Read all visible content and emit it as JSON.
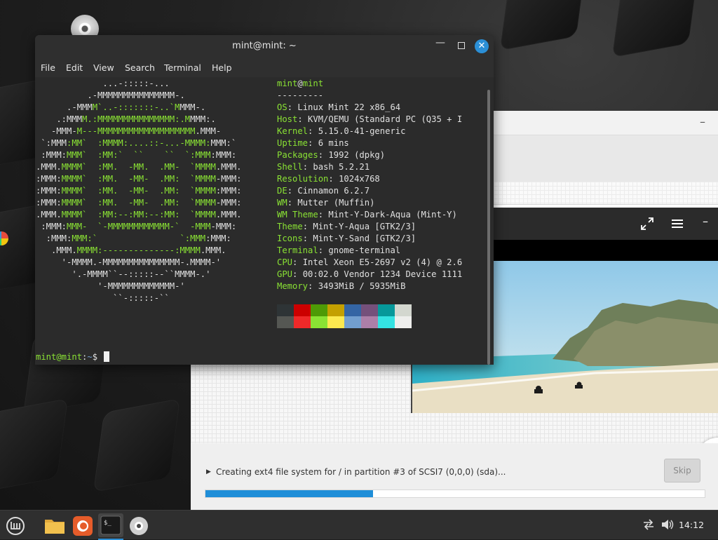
{
  "terminal": {
    "title": "mint@mint: ~",
    "menu": [
      "File",
      "Edit",
      "Search",
      "Terminal",
      "Help"
    ],
    "user": "mint",
    "host": "mint",
    "separator": "---------",
    "info": [
      {
        "key": "OS",
        "value": "Linux Mint 22 x86_64"
      },
      {
        "key": "Host",
        "value": "KVM/QEMU (Standard PC (Q35 + I"
      },
      {
        "key": "Kernel",
        "value": "5.15.0-41-generic"
      },
      {
        "key": "Uptime",
        "value": "6 mins"
      },
      {
        "key": "Packages",
        "value": "1992 (dpkg)"
      },
      {
        "key": "Shell",
        "value": "bash 5.2.21"
      },
      {
        "key": "Resolution",
        "value": "1024x768"
      },
      {
        "key": "DE",
        "value": "Cinnamon 6.2.7"
      },
      {
        "key": "WM",
        "value": "Mutter (Muffin)"
      },
      {
        "key": "WM Theme",
        "value": "Mint-Y-Dark-Aqua (Mint-Y)"
      },
      {
        "key": "Theme",
        "value": "Mint-Y-Aqua [GTK2/3]"
      },
      {
        "key": "Icons",
        "value": "Mint-Y-Sand [GTK2/3]"
      },
      {
        "key": "Terminal",
        "value": "gnome-terminal"
      },
      {
        "key": "CPU",
        "value": "Intel Xeon E5-2697 v2 (4) @ 2.6"
      },
      {
        "key": "GPU",
        "value": "00:02.0 Vendor 1234 Device 1111"
      },
      {
        "key": "Memory",
        "value": "3493MiB / 5935MiB"
      }
    ],
    "ascii_logo": [
      "             ...-:::::-...",
      "          .-MMMMMMMMMMMMMMM-.",
      "      .-MMMM`..-:::::::-..`MMMM-.",
      "    .:MMMM.:MMMMMMMMMMMMMMM:.MMMM:.",
      "   -MMM-M---MMMMMMMMMMMMMMMMMMM.MMM-",
      " `:MMM:MM`  :MMMM:....::-...-MMMM:MMM:`",
      " :MMM:MMM`  :MM:`  ``    ``  `:MMM:MMM:",
      ".MMM.MMMM`  :MM.  -MM.  .MM-  `MMMM.MMM.",
      ":MMM:MMMM`  :MM.  -MM-  .MM:  `MMMM-MMM:",
      ":MMM:MMMM`  :MM.  -MM-  .MM:  `MMMM:MMM:",
      ":MMM:MMMM`  :MM.  -MM-  .MM:  `MMMM-MMM:",
      ".MMM.MMMM`  :MM:--:MM:--:MM:  `MMMM.MMM.",
      " :MMM:MMM-  `-MMMMMMMMMMMM-`  -MMM-MMM:",
      "  :MMM:MMM:`                `:MMM:MMM:",
      "   .MMM.MMMM:--------------:MMMM.MMM.",
      "     '-MMMM.-MMMMMMMMMMMMMMM-.MMMM-'",
      "       '.-MMMM``--:::::--``MMMM-.'",
      "            '-MMMMMMMMMMMMM-'",
      "               ``-:::::-``"
    ],
    "prompt_user": "mint@mint",
    "prompt_path": "~",
    "prompt_symbol": "$"
  },
  "palette": {
    "dark": [
      "#2e3436",
      "#cc0000",
      "#4e9a06",
      "#c4a000",
      "#3465a4",
      "#75507b",
      "#06989a",
      "#d3d7cf"
    ],
    "bright": [
      "#555753",
      "#ef2929",
      "#8ae234",
      "#fce94f",
      "#729fcf",
      "#ad7fa8",
      "#34e2e2",
      "#eeeeec"
    ]
  },
  "installer": {
    "progress_text": "Creating ext4 file system for / in partition #3 of SCSI7 (0,0,0) (sda)...",
    "skip_label": "Skip",
    "progress_fraction": 0.335
  },
  "panel": {
    "clock": "14:12"
  }
}
